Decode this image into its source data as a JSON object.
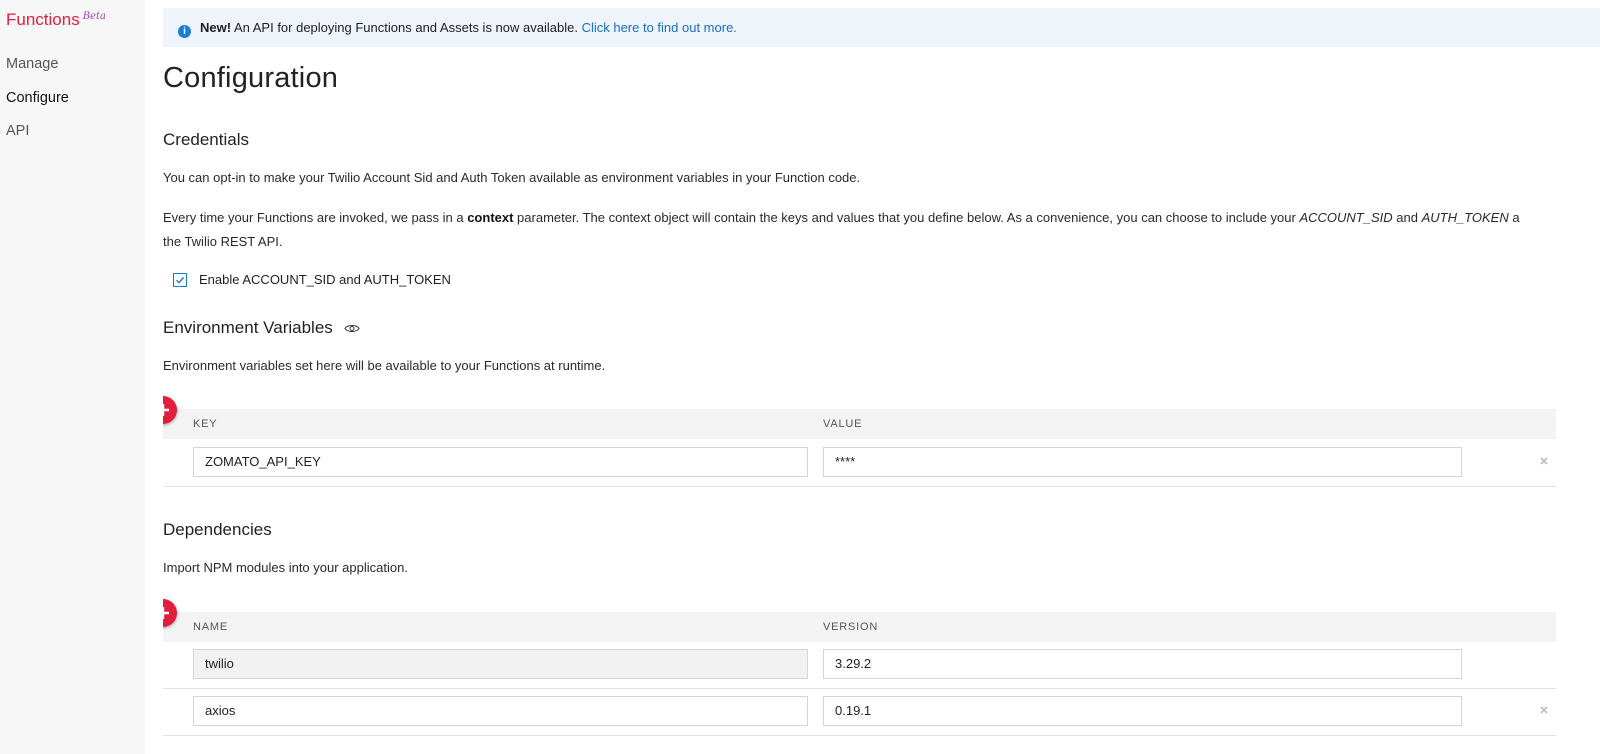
{
  "sidebar": {
    "brand": "Functions",
    "brand_badge": "Beta",
    "items": [
      {
        "label": "Manage"
      },
      {
        "label": "Configure"
      },
      {
        "label": "API"
      }
    ]
  },
  "banner": {
    "icon": "info-icon",
    "bold": "New!",
    "text": " An API for deploying Functions and Assets is now available. ",
    "link": "Click here to find out more."
  },
  "page": {
    "title": "Configuration"
  },
  "credentials": {
    "title": "Credentials",
    "intro": "You can opt-in to make your Twilio Account Sid and Auth Token available as environment variables in your Function code.",
    "detail": {
      "p1": "Every time your Functions are invoked, we pass in a ",
      "bold": "context",
      "p2": " parameter. The context object will contain the keys and values that you define below. As a convenience, you can choose to include your ",
      "i1": "ACCOUNT_SID",
      "p3": " and ",
      "i2": "AUTH_TOKEN",
      "p4": " a",
      "line2": "the Twilio REST API."
    },
    "checkbox_label": "Enable ACCOUNT_SID and AUTH_TOKEN",
    "checkbox_checked": true
  },
  "env": {
    "title": "Environment Variables",
    "description": "Environment variables set here will be available to your Functions at runtime.",
    "columns": [
      "KEY",
      "VALUE"
    ],
    "rows": [
      {
        "key": "ZOMATO_API_KEY",
        "value": "****"
      }
    ]
  },
  "deps": {
    "title": "Dependencies",
    "description": "Import NPM modules into your application.",
    "columns": [
      "NAME",
      "VERSION"
    ],
    "rows": [
      {
        "name": "twilio",
        "version": "3.29.2"
      },
      {
        "name": "axios",
        "version": "0.19.1"
      }
    ]
  },
  "colors": {
    "brand": "#e31e3d",
    "beta": "#a243b9",
    "link": "#1a6fc4",
    "banner_bg": "#eef4fa",
    "checkbox": "#1b7dd6"
  }
}
